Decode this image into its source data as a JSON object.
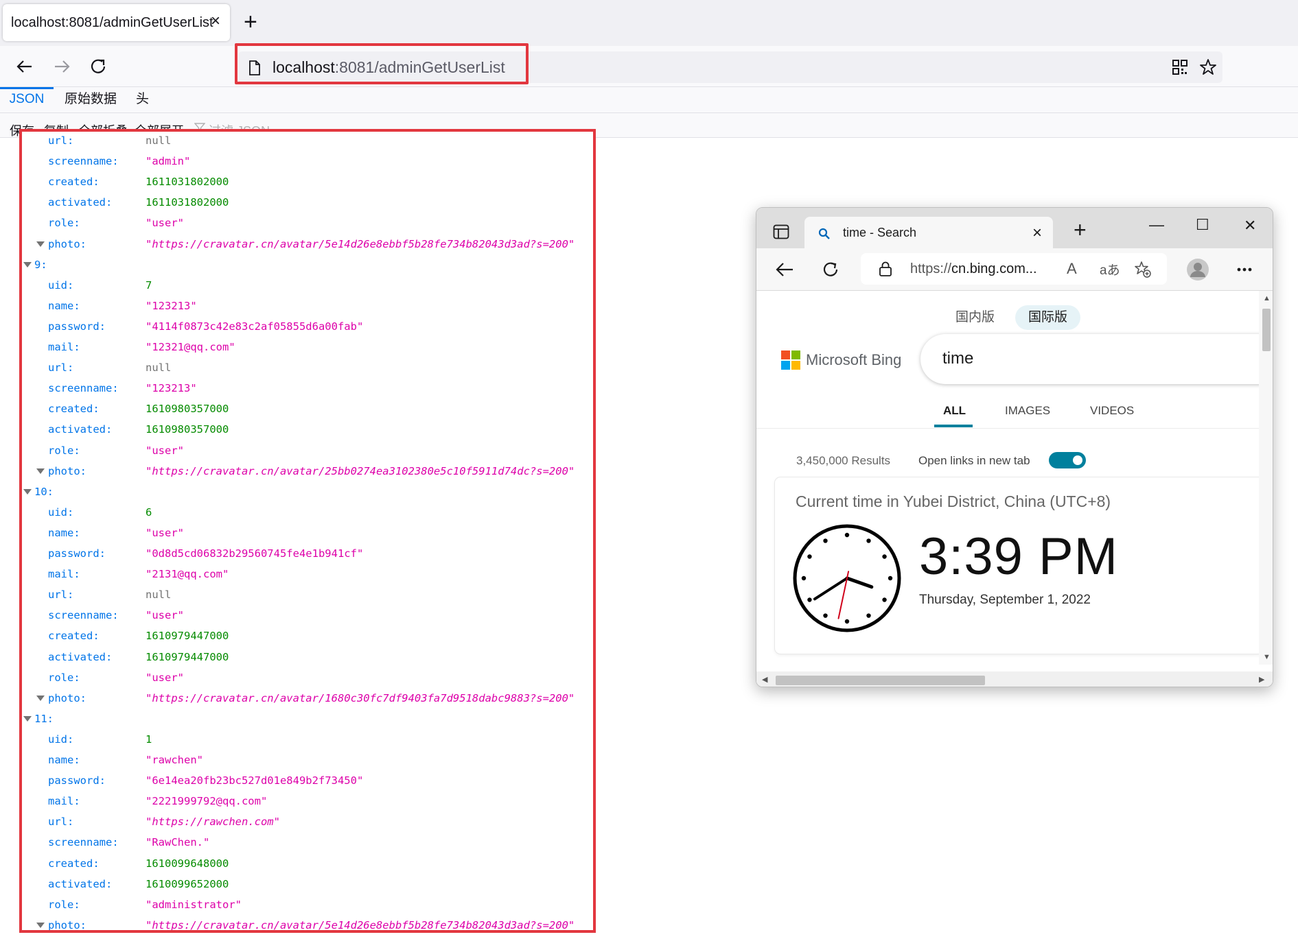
{
  "firefox": {
    "tab_title": "localhost:8081/adminGetUserList",
    "tab_close": "×",
    "new_tab": "+",
    "url_host": "localhost",
    "url_rest": ":8081/adminGetUserList",
    "viewer_tabs": [
      "JSON",
      "原始数据",
      "头"
    ],
    "toolbar": {
      "save": "保存",
      "copy": "复制",
      "collapse_all": "全部折叠",
      "expand_all": "全部展开",
      "filter": "过滤 JSON"
    }
  },
  "json_rows": [
    {
      "key": "url:",
      "value": "null",
      "type": "nul"
    },
    {
      "key": "screenname:",
      "value": "\"admin\"",
      "type": "str"
    },
    {
      "key": "created:",
      "value": "1611031802000",
      "type": "num"
    },
    {
      "key": "activated:",
      "value": "1611031802000",
      "type": "num"
    },
    {
      "key": "role:",
      "value": "\"user\"",
      "type": "str"
    },
    {
      "key": "photo:",
      "value": "\"https://cravatar.cn/avatar/5e14d26e8ebbf5b28fe734b82043d3ad?s=200\"",
      "type": "url",
      "twisty": true
    },
    {
      "key": "9:",
      "value": "",
      "type": "obj",
      "twisty": true
    },
    {
      "key": "uid:",
      "value": "7",
      "type": "num"
    },
    {
      "key": "name:",
      "value": "\"123213\"",
      "type": "str"
    },
    {
      "key": "password:",
      "value": "\"4114f0873c42e83c2af05855d6a00fab\"",
      "type": "str"
    },
    {
      "key": "mail:",
      "value": "\"12321@qq.com\"",
      "type": "str"
    },
    {
      "key": "url:",
      "value": "null",
      "type": "nul"
    },
    {
      "key": "screenname:",
      "value": "\"123213\"",
      "type": "str"
    },
    {
      "key": "created:",
      "value": "1610980357000",
      "type": "num"
    },
    {
      "key": "activated:",
      "value": "1610980357000",
      "type": "num"
    },
    {
      "key": "role:",
      "value": "\"user\"",
      "type": "str"
    },
    {
      "key": "photo:",
      "value": "\"https://cravatar.cn/avatar/25bb0274ea3102380e5c10f5911d74dc?s=200\"",
      "type": "url",
      "twisty": true
    },
    {
      "key": "10:",
      "value": "",
      "type": "obj",
      "twisty": true
    },
    {
      "key": "uid:",
      "value": "6",
      "type": "num"
    },
    {
      "key": "name:",
      "value": "\"user\"",
      "type": "str"
    },
    {
      "key": "password:",
      "value": "\"0d8d5cd06832b29560745fe4e1b941cf\"",
      "type": "str"
    },
    {
      "key": "mail:",
      "value": "\"2131@qq.com\"",
      "type": "str"
    },
    {
      "key": "url:",
      "value": "null",
      "type": "nul"
    },
    {
      "key": "screenname:",
      "value": "\"user\"",
      "type": "str"
    },
    {
      "key": "created:",
      "value": "1610979447000",
      "type": "num"
    },
    {
      "key": "activated:",
      "value": "1610979447000",
      "type": "num"
    },
    {
      "key": "role:",
      "value": "\"user\"",
      "type": "str"
    },
    {
      "key": "photo:",
      "value": "\"https://cravatar.cn/avatar/1680c30fc7df9403fa7d9518dabc9883?s=200\"",
      "type": "url",
      "twisty": true
    },
    {
      "key": "11:",
      "value": "",
      "type": "obj",
      "twisty": true
    },
    {
      "key": "uid:",
      "value": "1",
      "type": "num"
    },
    {
      "key": "name:",
      "value": "\"rawchen\"",
      "type": "str"
    },
    {
      "key": "password:",
      "value": "\"6e14ea20fb23bc527d01e849b2f73450\"",
      "type": "str"
    },
    {
      "key": "mail:",
      "value": "\"2221999792@qq.com\"",
      "type": "str"
    },
    {
      "key": "url:",
      "value": "\"https://rawchen.com\"",
      "type": "url"
    },
    {
      "key": "screenname:",
      "value": "\"RawChen.\"",
      "type": "str"
    },
    {
      "key": "created:",
      "value": "1610099648000",
      "type": "num"
    },
    {
      "key": "activated:",
      "value": "1610099652000",
      "type": "num"
    },
    {
      "key": "role:",
      "value": "\"administrator\"",
      "type": "str"
    },
    {
      "key": "photo:",
      "value": "\"https://cravatar.cn/avatar/5e14d26e8ebbf5b28fe734b82043d3ad?s=200\"",
      "type": "url",
      "twisty": true
    }
  ],
  "edge": {
    "tab_title": "time - Search",
    "tab_close": "×",
    "new_tab": "+",
    "minimize": "—",
    "maximize": "☐",
    "close": "✕",
    "url_prefix": "https://",
    "url_host": "cn.bing.com...",
    "read_aloud": "A",
    "translate": "aあ"
  },
  "bing": {
    "scope_domestic": "国内版",
    "scope_intl": "国际版",
    "logo_text": "Microsoft Bing",
    "query": "time",
    "nav": [
      "ALL",
      "IMAGES",
      "VIDEOS"
    ],
    "result_count": "3,450,000 Results",
    "open_links_label": "Open links in new tab",
    "card_title": "Current time in Yubei District, China (UTC+8)",
    "time": "3:39 PM",
    "date": "Thursday, September 1, 2022",
    "clock": {
      "hour": 15,
      "minute": 39,
      "second": 32
    }
  }
}
